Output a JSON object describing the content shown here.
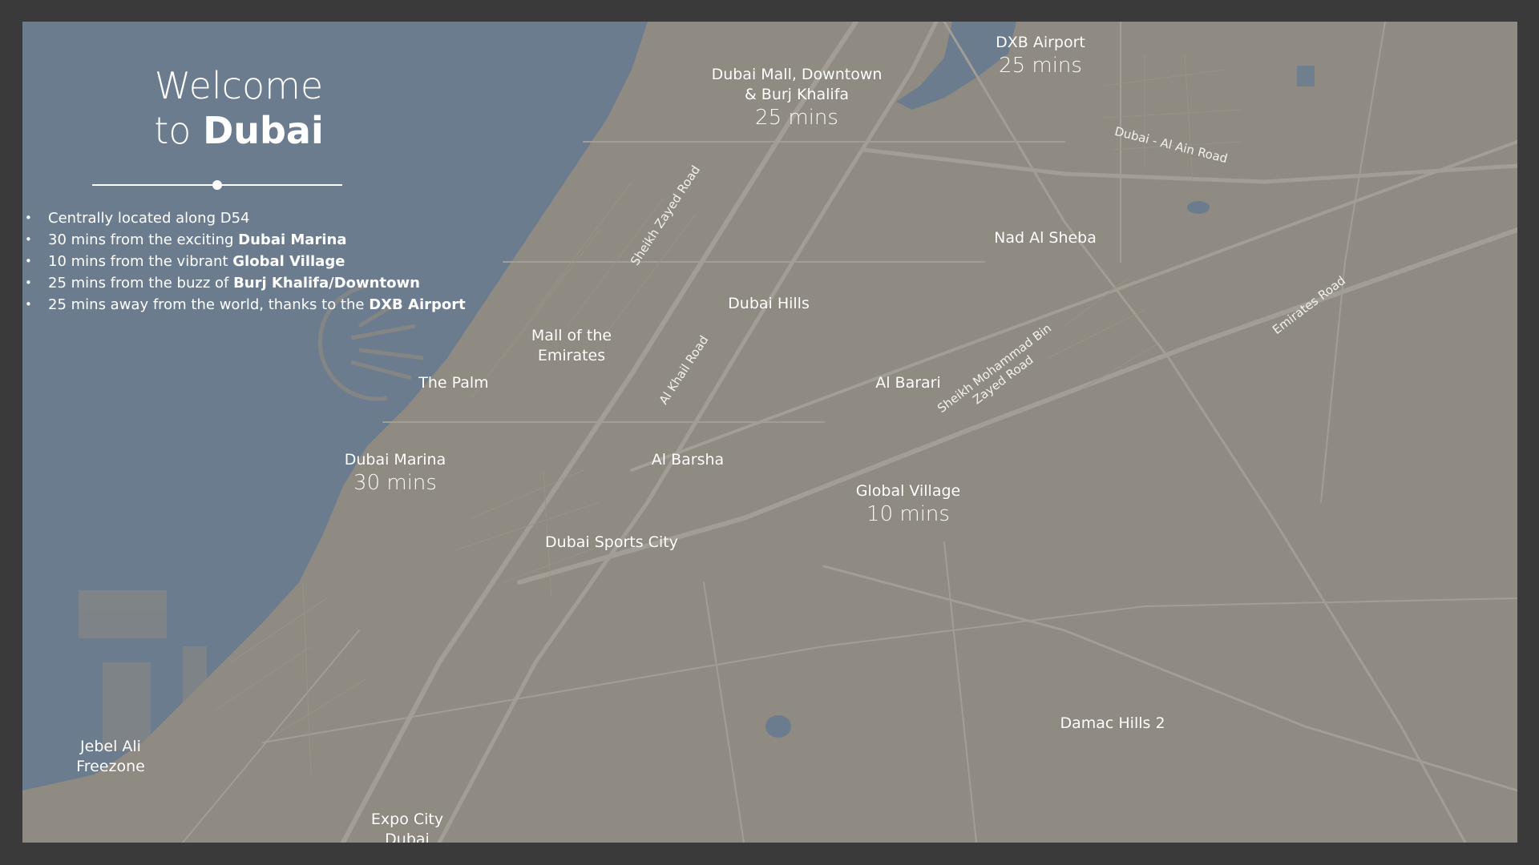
{
  "welcome": {
    "line1": "Welcome",
    "line2_prefix": "to",
    "line2_bold": "Dubai"
  },
  "bullets": [
    {
      "text": "Centrally located along D54",
      "bold": ""
    },
    {
      "text": "30 mins from the exciting",
      "bold": "Dubai Marina"
    },
    {
      "text": "10 mins from the vibrant",
      "bold": "Global Village"
    },
    {
      "text": "25 mins from the buzz of",
      "bold": "Burj Khalifa/Downtown"
    },
    {
      "text": "25 mins away from the world, thanks to the",
      "bold": "DXB Airport"
    }
  ],
  "places": {
    "dxb_airport": {
      "name": "DXB Airport",
      "time": "25 mins"
    },
    "dubai_mall": {
      "name_line1": "Dubai Mall, Downtown",
      "name_line2": "& Burj Khalifa",
      "time": "25 mins"
    },
    "nad_al_sheba": "Nad Al Sheba",
    "dubai_hills": "Dubai Hills",
    "mall_of_emirates": {
      "name_line1": "Mall of the",
      "name_line2": "Emirates"
    },
    "the_palm": "The Palm",
    "al_barari": "Al Barari",
    "dubai_marina": {
      "name": "Dubai Marina",
      "time": "30 mins"
    },
    "al_barsha": "Al Barsha",
    "global_village": {
      "name": "Global Village",
      "time": "10 mins"
    },
    "dubai_sports_city": "Dubai Sports City",
    "damac_hills_2": "Damac Hills 2",
    "jebel_ali": {
      "name_line1": "Jebel Ali",
      "name_line2": "Freezone"
    },
    "expo_city": {
      "name_line1": "Expo City",
      "name_line2": "Dubai"
    }
  },
  "roads": {
    "sheikh_zayed": "Sheikh Zayed Road",
    "al_khail": "Al Khail Road",
    "dubai_al_ain": "Dubai - Al Ain Road",
    "emirates": "Emirates Road",
    "smbz_line1": "Sheikh Mohammad Bin",
    "smbz_line2": "Zayed Road"
  },
  "colors": {
    "frame": "#3a3a3a",
    "land": "#8f8a82",
    "water": "#6b7c8f",
    "road_lines": "#a29d95",
    "text": "#ffffff"
  }
}
